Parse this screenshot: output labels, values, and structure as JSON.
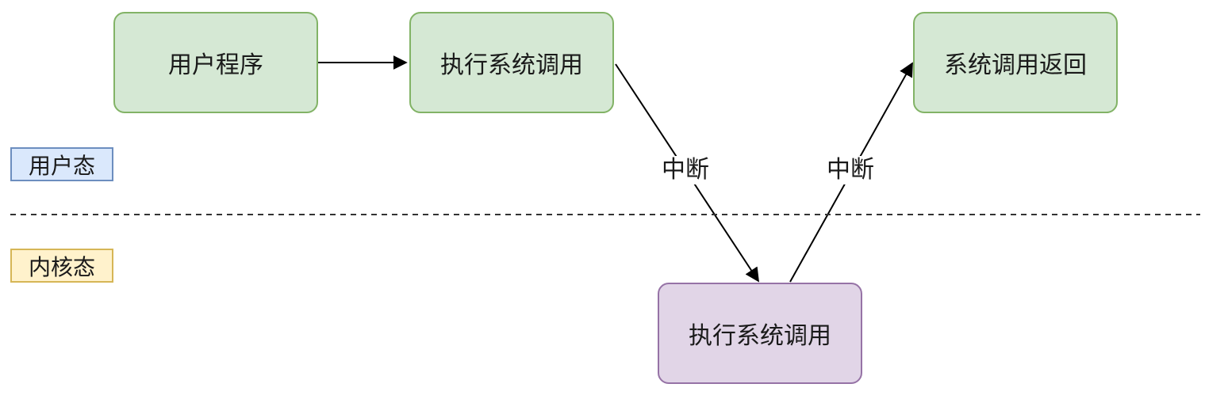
{
  "nodes": {
    "user_program": "用户程序",
    "exec_syscall_user": "执行系统调用",
    "syscall_return": "系统调用返回",
    "exec_syscall_kernel": "执行系统调用"
  },
  "modes": {
    "user": "用户态",
    "kernel": "内核态"
  },
  "edges": {
    "interrupt_down": "中断",
    "interrupt_up": "中断"
  },
  "colors": {
    "green_fill": "#d5e8d4",
    "green_stroke": "#82b366",
    "purple_fill": "#e1d5e7",
    "purple_stroke": "#9673a6",
    "blue_fill": "#dae8fc",
    "yellow_fill": "#fff2cc"
  }
}
